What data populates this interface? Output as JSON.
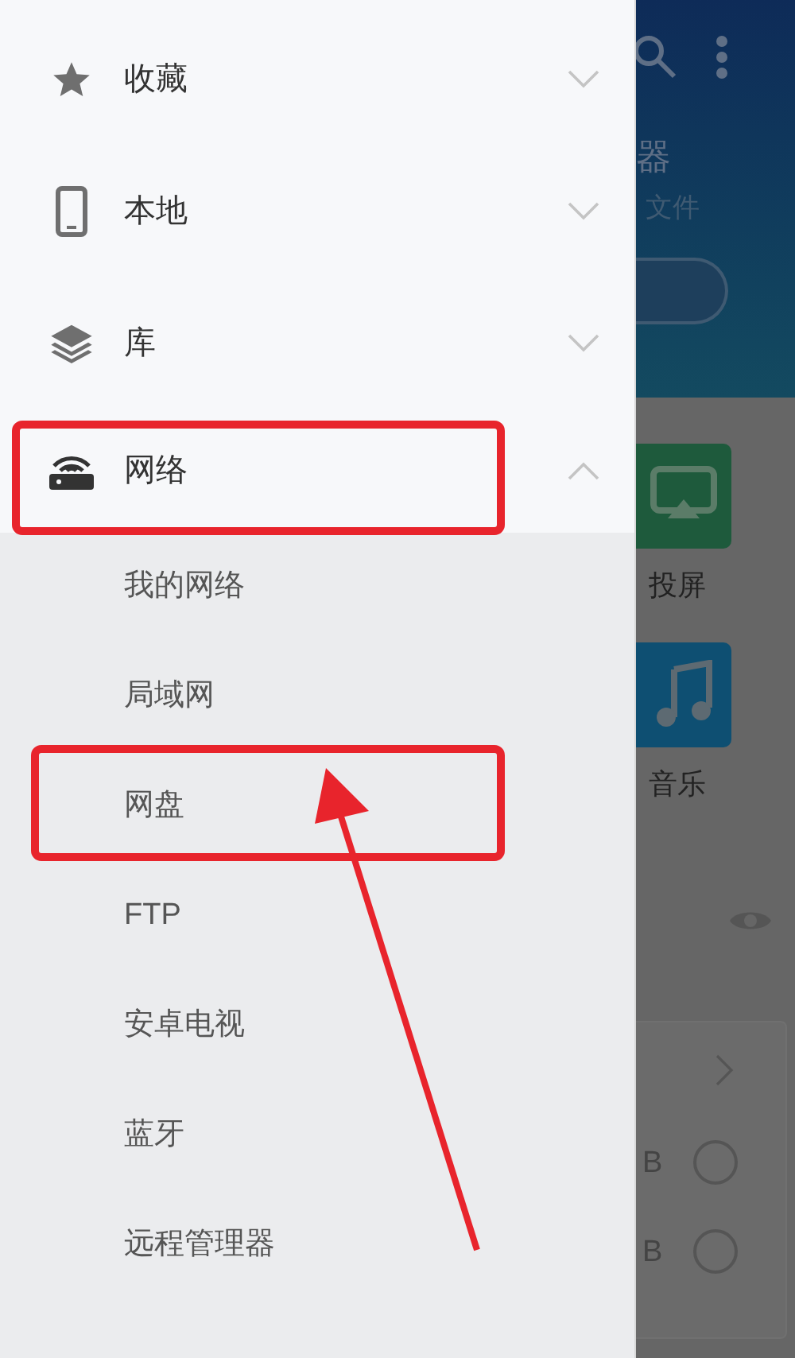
{
  "drawer": {
    "items": [
      {
        "label": "收藏",
        "expanded": false
      },
      {
        "label": "本地",
        "expanded": false
      },
      {
        "label": "库",
        "expanded": false
      },
      {
        "label": "网络",
        "expanded": true,
        "children": [
          {
            "label": "我的网络"
          },
          {
            "label": "局域网"
          },
          {
            "label": "网盘"
          },
          {
            "label": "FTP"
          },
          {
            "label": "安卓电视"
          },
          {
            "label": "蓝牙"
          },
          {
            "label": "远程管理器"
          }
        ]
      }
    ]
  },
  "background": {
    "header_title": "器",
    "header_subtitle": "文件",
    "tiles": [
      {
        "label": "投屏",
        "kind": "cast"
      },
      {
        "label": "音乐",
        "kind": "music"
      }
    ],
    "rows": [
      {
        "size": "B",
        "selected": false
      },
      {
        "size": "B",
        "selected": false
      }
    ]
  }
}
